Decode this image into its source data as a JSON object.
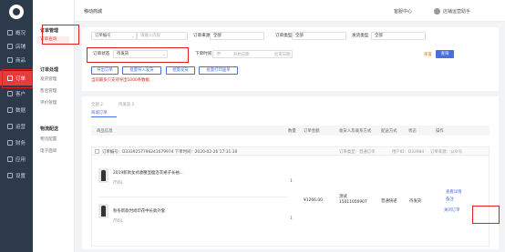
{
  "sidebar": {
    "items": [
      {
        "label": "概况",
        "icon": "home-icon"
      },
      {
        "label": "店铺",
        "icon": "shop-icon"
      },
      {
        "label": "商品",
        "icon": "goods-icon"
      },
      {
        "label": "订单",
        "icon": "order-icon"
      },
      {
        "label": "客户",
        "icon": "customer-icon"
      },
      {
        "label": "数据",
        "icon": "data-icon"
      },
      {
        "label": "运营",
        "icon": "operation-icon"
      },
      {
        "label": "财务",
        "icon": "finance-icon"
      },
      {
        "label": "应用",
        "icon": "app-icon"
      },
      {
        "label": "设置",
        "icon": "settings-icon"
      }
    ]
  },
  "submenu": {
    "group1": "订单管理",
    "item1": "订单查询",
    "group2": "订单处理",
    "group2_items": [
      "发货管理",
      "售后管理",
      "评价管理"
    ],
    "group3": "物流配送",
    "group3_items": [
      "物流配置",
      "电子面单"
    ]
  },
  "header": {
    "breadcrumb": "移动商城",
    "help": "客服中心",
    "user": "店铺运营助手"
  },
  "filters": {
    "order_no": "订单编号",
    "keyword_ph": "请输入内容",
    "source_label": "订单来源",
    "source_val": "全部",
    "type_label": "订单类型",
    "type_val": "全部",
    "ship_label": "发货类型",
    "ship_val": "全部",
    "status_label": "订单状态",
    "status_val": "待发货",
    "time_label": "下单时间",
    "start_ph": "开始日期",
    "end_ph": "结束日期",
    "reset": "重置",
    "search": "查询"
  },
  "actions": {
    "export": "导出订单",
    "batch_import": "批量导入发货",
    "batch_ship": "批量发货",
    "batch_print": "批量打印面单",
    "warning": "当前最多只支持导出1000条数据"
  },
  "tabs": {
    "t1": "全部 2",
    "t2": "待发货 2",
    "sub": "商城订单"
  },
  "table": {
    "headers": [
      "商品信息",
      "数量",
      "订单金额",
      "收货人及联系方式",
      "配送方式",
      "状态",
      "操作"
    ]
  },
  "order": {
    "header": "订单编号：D3339257796241679974 下单时间：2020-02-26 17:31:30",
    "right1": "订单类型：普通订单",
    "right2": "用户ID：D33984",
    "right3": "订单来源：公众号",
    "items": [
      {
        "name": "2019新款女式收腰显瘦连衣裙子长袖...",
        "spec": "尺码L",
        "qty": "1"
      },
      {
        "name": "秋冬新款时尚印花中长款外套",
        "spec": "尺码L",
        "qty": "1"
      }
    ],
    "amount": "¥1266.00",
    "receiver": "测试",
    "phone": "15011056907",
    "delivery": "普通快递",
    "status": "待发货",
    "op1": "查看详情",
    "op2": "备注",
    "op3": "关闭订单"
  }
}
